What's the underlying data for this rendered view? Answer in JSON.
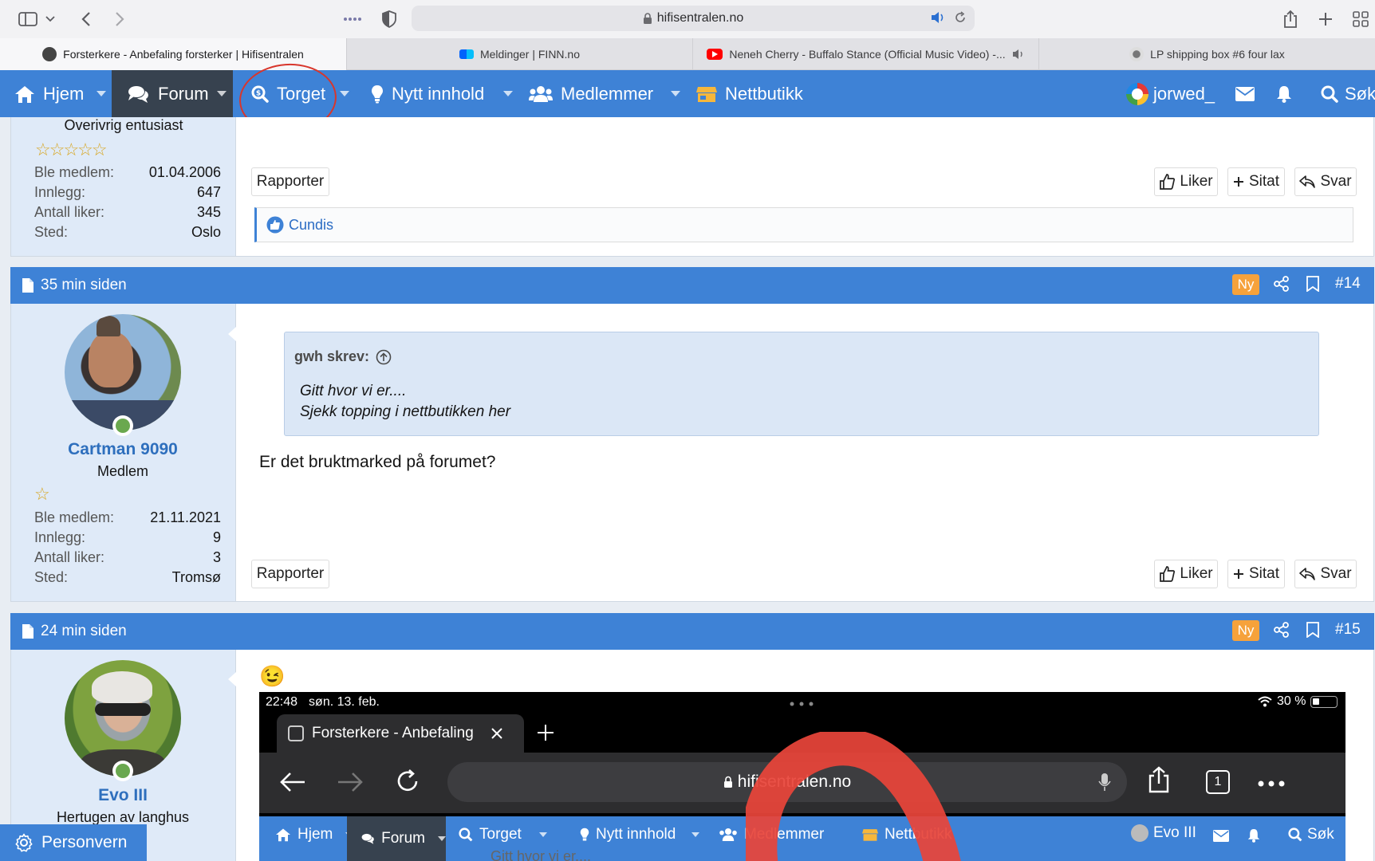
{
  "browser": {
    "url": "hifisentralen.no",
    "tabs": [
      {
        "label": "Forsterkere - Anbefaling forsterker | Hifisentralen",
        "active": true
      },
      {
        "label": "Meldinger | FINN.no",
        "active": false
      },
      {
        "label": "Neneh Cherry - Buffalo Stance (Official Music Video) -...",
        "active": false
      },
      {
        "label": "LP shipping box #6 four lax",
        "active": false
      }
    ]
  },
  "nav": {
    "items": [
      "Hjem",
      "Forum",
      "Torget",
      "Nytt innhold",
      "Medlemmer",
      "Nettbutikk"
    ],
    "username": "jorwed_",
    "search": "Søk"
  },
  "prev_post": {
    "user_title": "Overivrig entusiast",
    "stats": [
      {
        "k": "Ble medlem:",
        "v": "01.04.2006"
      },
      {
        "k": "Innlegg:",
        "v": "647"
      },
      {
        "k": "Antall liker:",
        "v": "345"
      },
      {
        "k": "Sted:",
        "v": "Oslo"
      }
    ],
    "report": "Rapporter",
    "like": "Liker",
    "quote": "Sitat",
    "reply": "Svar",
    "liked_by": "Cundis"
  },
  "post14": {
    "time": "35 min siden",
    "badge": "Ny",
    "number": "#14",
    "username": "Cartman 9090",
    "user_title": "Medlem",
    "stats": [
      {
        "k": "Ble medlem:",
        "v": "21.11.2021"
      },
      {
        "k": "Innlegg:",
        "v": "9"
      },
      {
        "k": "Antall liker:",
        "v": "3"
      },
      {
        "k": "Sted:",
        "v": "Tromsø"
      }
    ],
    "quote_author": "gwh skrev:",
    "quote_line1": "Gitt hvor vi er....",
    "quote_line2": "Sjekk topping i nettbutikken her",
    "body": "Er det bruktmarked på forumet?",
    "report": "Rapporter",
    "like": "Liker",
    "quote": "Sitat",
    "reply": "Svar"
  },
  "post15": {
    "time": "24 min siden",
    "badge": "Ny",
    "number": "#15",
    "username": "Evo III",
    "user_title": "Hertugen av langhus",
    "emoji": "😉",
    "embedded": {
      "time": "22:48",
      "date": "søn. 13. feb.",
      "battery": "30 %",
      "tab_label": "Forsterkere - Anbefaling",
      "url": "hifisentralen.no",
      "tab_count": "1",
      "nav": [
        "Hjem",
        "Forum",
        "Torget",
        "Nytt innhold",
        "Medlemmer",
        "Nettbutikk"
      ],
      "user": "Evo III",
      "search": "Søk",
      "peek_text": "Gitt hvor vi er...."
    }
  },
  "footer_button": "Personvern",
  "colors": {
    "nav_blue": "#3e82d6",
    "user_panel": "#dfeaf8",
    "badge_orange": "#f6a23b",
    "annotation_red": "#d8362c"
  }
}
